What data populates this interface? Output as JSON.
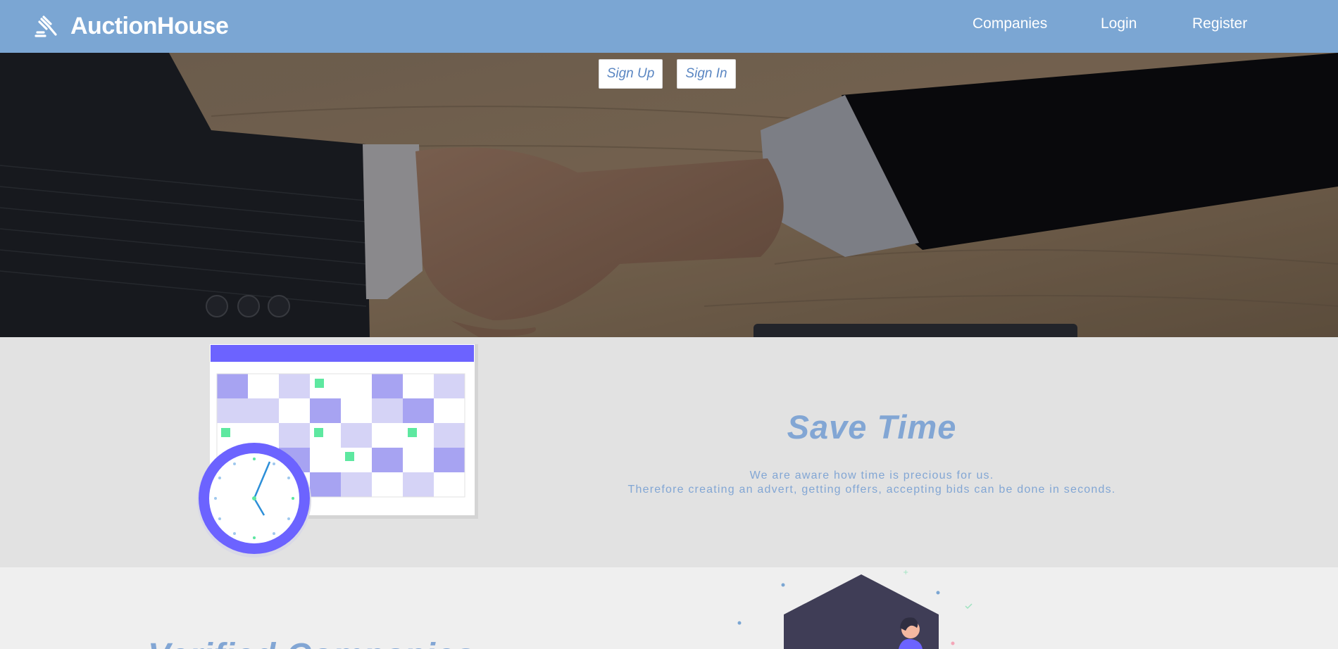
{
  "navbar": {
    "brand": "AuctionHouse",
    "brand_icon": "gavel-icon",
    "links": [
      "Companies",
      "Login",
      "Register"
    ]
  },
  "hero": {
    "signup_label": "Sign Up",
    "signin_label": "Sign In",
    "image": "handshake-photo"
  },
  "save_time": {
    "title": "Save Time",
    "line1": "We are aware how time is precious for us.",
    "line2": "Therefore creating an advert, getting offers, accepting bids can be done in seconds.",
    "illustration": "calendar-clock-illustration"
  },
  "verified": {
    "title": "Verified Companies",
    "illustration": "verified-person-illustration"
  },
  "colors": {
    "nav": "#7ba6d3",
    "accent_text": "#82a6d4",
    "illustration_purple": "#6c63ff",
    "illustration_green": "#5ee8a0"
  }
}
